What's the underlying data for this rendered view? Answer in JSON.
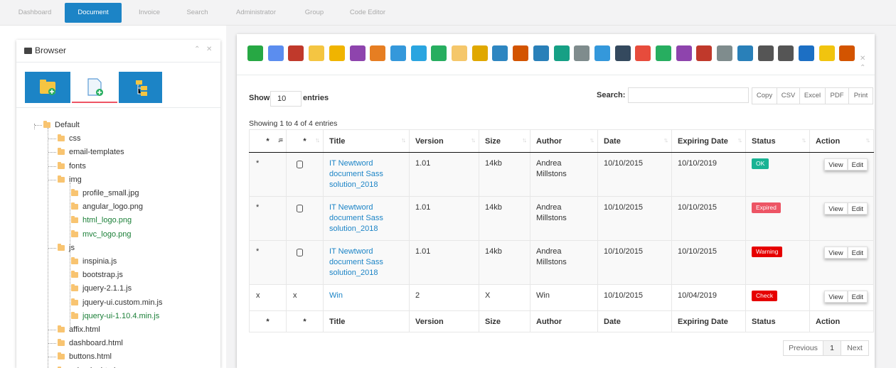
{
  "nav": {
    "tabs": [
      {
        "label": "Dashboard",
        "active": false
      },
      {
        "label": "Document",
        "active": true
      },
      {
        "label": "Invoice",
        "active": false
      },
      {
        "label": "Search",
        "active": false
      },
      {
        "label": "Administrator",
        "active": false
      },
      {
        "label": "Group",
        "active": false
      },
      {
        "label": "Code Editor",
        "active": false
      }
    ]
  },
  "browser": {
    "title": "Browser",
    "tabs": [
      "folder-add-icon",
      "file-add-icon",
      "tree-icon"
    ],
    "tree": [
      {
        "label": "Default",
        "level": 0,
        "type": "folder",
        "green": false
      },
      {
        "label": "css",
        "level": 1,
        "type": "folder",
        "green": false
      },
      {
        "label": "email-templates",
        "level": 1,
        "type": "folder",
        "green": false
      },
      {
        "label": "fonts",
        "level": 1,
        "type": "folder",
        "green": false
      },
      {
        "label": "img",
        "level": 1,
        "type": "folder",
        "green": false
      },
      {
        "label": "profile_small.jpg",
        "level": 2,
        "type": "file",
        "green": false
      },
      {
        "label": "angular_logo.png",
        "level": 2,
        "type": "file",
        "green": false
      },
      {
        "label": "html_logo.png",
        "level": 2,
        "type": "file",
        "green": true
      },
      {
        "label": "mvc_logo.png",
        "level": 2,
        "type": "file",
        "green": true
      },
      {
        "label": "js",
        "level": 1,
        "type": "folder",
        "green": false
      },
      {
        "label": "inspinia.js",
        "level": 2,
        "type": "file",
        "green": false
      },
      {
        "label": "bootstrap.js",
        "level": 2,
        "type": "file",
        "green": false
      },
      {
        "label": "jquery-2.1.1.js",
        "level": 2,
        "type": "file",
        "green": false
      },
      {
        "label": "jquery-ui.custom.min.js",
        "level": 2,
        "type": "file",
        "green": false
      },
      {
        "label": "jquery-ui-1.10.4.min.js",
        "level": 2,
        "type": "file",
        "green": true
      },
      {
        "label": "affix.html",
        "level": 1,
        "type": "file",
        "green": false
      },
      {
        "label": "dashboard.html",
        "level": 1,
        "type": "file",
        "green": false
      },
      {
        "label": "buttons.html",
        "level": 1,
        "type": "file",
        "green": false
      },
      {
        "label": "calendar.html",
        "level": 1,
        "type": "file",
        "green": false
      }
    ]
  },
  "toolbar": {
    "icons": [
      {
        "name": "download-icon",
        "color": "#27a844"
      },
      {
        "name": "zip-file-icon",
        "color": "#5b8def"
      },
      {
        "name": "stamp-icon",
        "color": "#c0392b"
      },
      {
        "name": "folder-tree-icon",
        "color": "#f4c542"
      },
      {
        "name": "folder-star-icon",
        "color": "#f0b400"
      },
      {
        "name": "archive-books-icon",
        "color": "#8e44ad"
      },
      {
        "name": "zip-archive-icon",
        "color": "#e67e22"
      },
      {
        "name": "edit-document-icon",
        "color": "#3498db"
      },
      {
        "name": "windows-icon",
        "color": "#2aa5e0"
      },
      {
        "name": "www-icon",
        "color": "#27ae60"
      },
      {
        "name": "open-folder-icon",
        "color": "#f5c76b"
      },
      {
        "name": "key-icon",
        "color": "#e0a800"
      },
      {
        "name": "spreadsheet-icon",
        "color": "#2e86c1"
      },
      {
        "name": "user-icon",
        "color": "#d35400"
      },
      {
        "name": "refresh-icon",
        "color": "#2980b9"
      },
      {
        "name": "users-add-icon",
        "color": "#16a085"
      },
      {
        "name": "database-refresh-icon",
        "color": "#7f8c8d"
      },
      {
        "name": "hierarchy-icon",
        "color": "#3498db"
      },
      {
        "name": "tools-icon",
        "color": "#34495e"
      },
      {
        "name": "alert-icon",
        "color": "#e74c3c"
      },
      {
        "name": "shuffle-icon",
        "color": "#27ae60"
      },
      {
        "name": "image-edit-icon",
        "color": "#8e44ad"
      },
      {
        "name": "line-chart-icon",
        "color": "#c0392b"
      },
      {
        "name": "unlink-icon",
        "color": "#7f8c8d"
      },
      {
        "name": "search-icon",
        "color": "#2980b9"
      },
      {
        "name": "traffic-light-icon",
        "color": "#555555"
      },
      {
        "name": "traffic-light-2-icon",
        "color": "#555555"
      },
      {
        "name": "info-icon",
        "color": "#1c6fc4"
      },
      {
        "name": "mail-icon",
        "color": "#f1c40f"
      },
      {
        "name": "upload-tray-icon",
        "color": "#d35400"
      }
    ]
  },
  "table_controls": {
    "show_label": "Show",
    "show_value": "10",
    "entries_label": "entries",
    "search_label": "Search:",
    "search_value": "",
    "export_buttons": [
      "Copy",
      "CSV",
      "Excel",
      "PDF",
      "Print"
    ],
    "info": "Showing 1 to 4 of 4 entries"
  },
  "table": {
    "headers": [
      "*",
      "*",
      "Title",
      "Version",
      "Size",
      "Author",
      "Date",
      "Expiring Date",
      "Status",
      "Action"
    ],
    "rows": [
      {
        "c1": "*",
        "c2": "db",
        "title": "IT Newtword document Sass solution_2018",
        "version": "1.01",
        "size": "14kb",
        "author": "Andrea Millstons",
        "date": "10/10/2015",
        "exp": "10/10/2019",
        "status": "OK",
        "status_color": "#1ab394"
      },
      {
        "c1": "*",
        "c2": "db",
        "title": "IT Newtword document Sass solution_2018",
        "version": "1.01",
        "size": "14kb",
        "author": "Andrea Millstons",
        "date": "10/10/2015",
        "exp": "10/10/2015",
        "status": "Expired",
        "status_color": "#ed5565"
      },
      {
        "c1": "*",
        "c2": "db",
        "title": "IT Newtword document Sass solution_2018",
        "version": "1.01",
        "size": "14kb",
        "author": "Andrea Millstons",
        "date": "10/10/2015",
        "exp": "10/10/2015",
        "status": "Warning",
        "status_color": "#e60000"
      },
      {
        "c1": "x",
        "c2": "x",
        "title": "Win",
        "version": "2",
        "size": "X",
        "author": "Win",
        "date": "10/10/2015",
        "exp": "10/04/2019",
        "status": "Check",
        "status_color": "#e60000"
      }
    ],
    "view_label": "View",
    "edit_label": "Edit"
  },
  "pagination": {
    "previous": "Previous",
    "page": "1",
    "next": "Next"
  }
}
